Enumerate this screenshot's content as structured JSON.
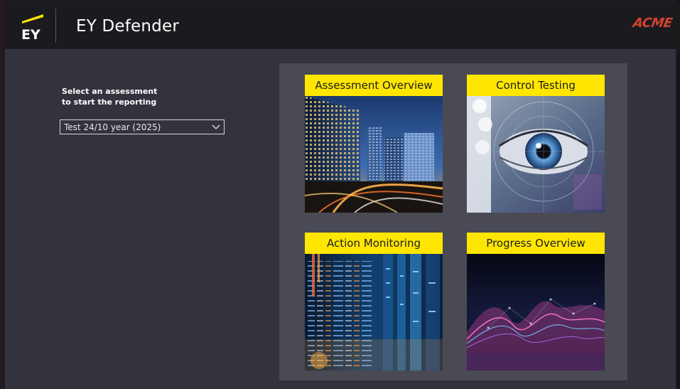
{
  "header": {
    "logo_text": "EY",
    "title": "EY Defender",
    "partner_logo": "ACME",
    "brand_color": "#ffe600",
    "partner_color": "#d2432f"
  },
  "selector": {
    "label_line1": "Select an assessment",
    "label_line2": "to start the reporting",
    "selected_value": "Test 24/10 year (2025)",
    "icon": "chevron-down-icon"
  },
  "tiles": [
    {
      "label": "Assessment Overview",
      "image": "skyscrapers-night-image"
    },
    {
      "label": "Control Testing",
      "image": "eye-scan-image"
    },
    {
      "label": "Action Monitoring",
      "image": "code-server-image"
    },
    {
      "label": "Progress Overview",
      "image": "data-waves-image"
    }
  ]
}
